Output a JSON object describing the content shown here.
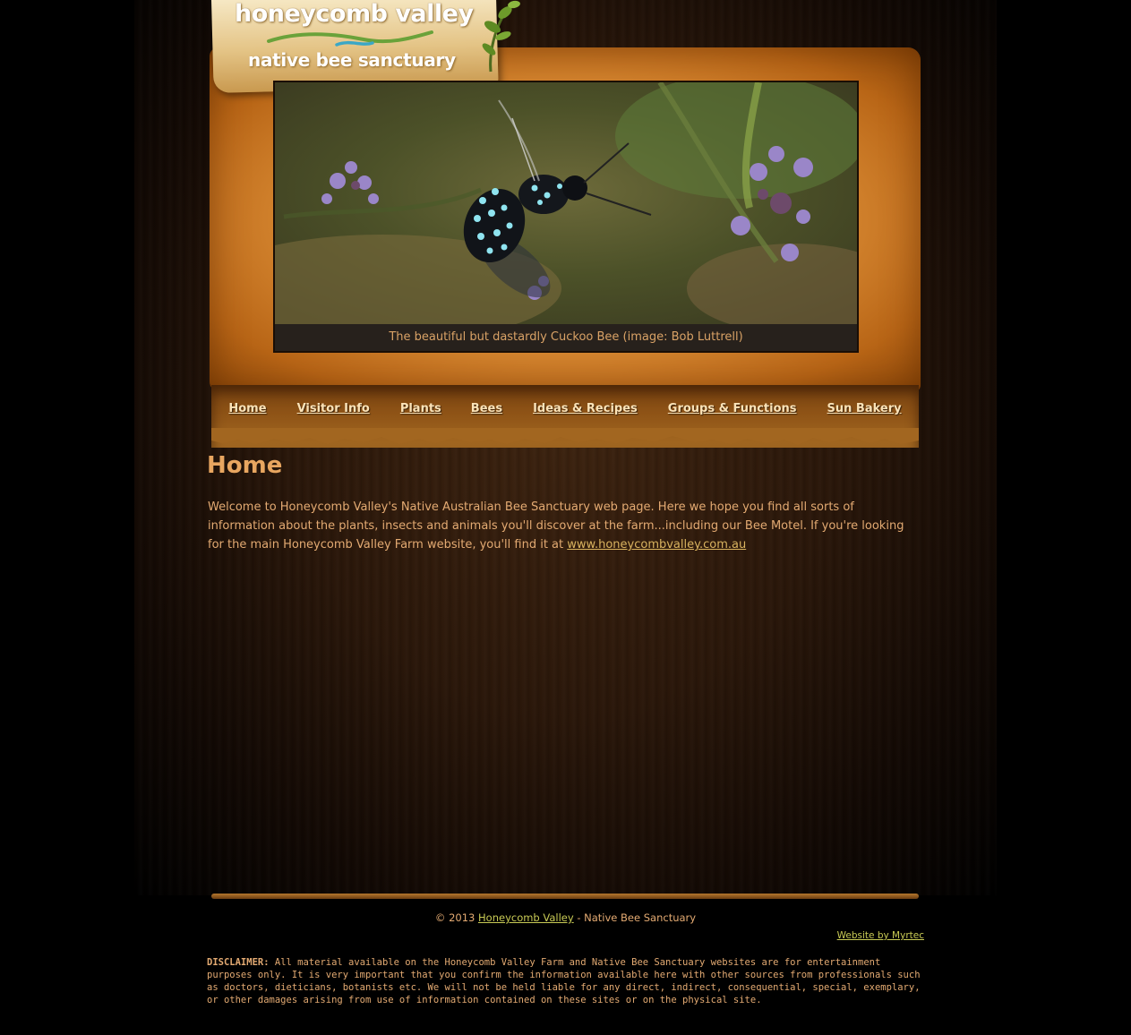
{
  "site": {
    "logo_title": "honeycomb valley",
    "logo_subtitle": "native bee sanctuary"
  },
  "hero": {
    "caption": "The beautiful but dastardly Cuckoo Bee (image: Bob Luttrell)"
  },
  "nav": {
    "items": [
      {
        "label": "Home"
      },
      {
        "label": "Visitor Info"
      },
      {
        "label": "Plants"
      },
      {
        "label": "Bees"
      },
      {
        "label": "Ideas & Recipes"
      },
      {
        "label": "Groups & Functions"
      },
      {
        "label": "Sun Bakery"
      }
    ]
  },
  "main": {
    "title": "Home",
    "intro": "Welcome to Honeycomb Valley's Native Australian Bee Sanctuary web page. Here we hope you find all sorts of information about the plants, insects and animals you'll discover at the farm...including our Bee Motel. If you're looking for the main Honeycomb Valley Farm website, you'll find it at",
    "link_text": "www.honeycombvalley.com.au"
  },
  "footer": {
    "copyright_prefix": "© 2013",
    "copyright_link": "Honeycomb Valley",
    "copyright_suffix": "- Native Bee Sanctuary",
    "credit_link": "Website by Myrtec",
    "disclaimer_label": "DISCLAIMER:",
    "disclaimer_text": "All material available on the Honeycomb Valley Farm and Native Bee Sanctuary websites are for entertainment purposes only. It is very important that you confirm the information available here with other sources from professionals such as doctors, dieticians, botanists etc. We will not be held liable for any direct, indirect, consequential, special, exemplary, or other damages arising from use of information contained on these sites or on the physical site."
  },
  "colors": {
    "background": "#000000",
    "text": "#e3aa72",
    "title": "#e8a660",
    "link": "#c9cb55",
    "nav_text": "#fbe3b8"
  }
}
